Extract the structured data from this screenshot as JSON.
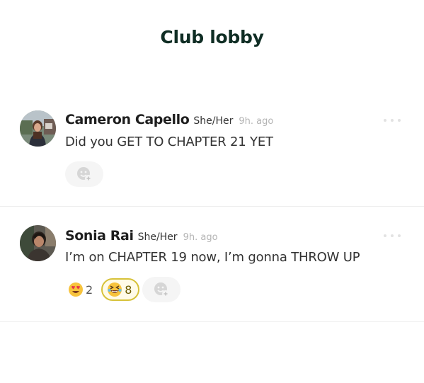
{
  "page": {
    "title": "Club lobby"
  },
  "messages": [
    {
      "author": "Cameron Capello",
      "pronouns": "She/Her",
      "time": "9h. ago",
      "text": "Did you GET TO CHAPTER 21 YET",
      "avatar_icon": "user-photo-avatar",
      "reactions": []
    },
    {
      "author": "Sonia Rai",
      "pronouns": "She/Her",
      "time": "9h. ago",
      "text": "I’m on CHAPTER 19 now, I’m gonna THROW UP",
      "avatar_icon": "user-photo-avatar",
      "reactions": [
        {
          "emoji": "heart-eyes-emoji",
          "count": "2",
          "selected": false
        },
        {
          "emoji": "grinning-squint-emoji",
          "count": "8",
          "selected": true
        }
      ]
    }
  ],
  "icons": {
    "add_reaction": "add-reaction-icon",
    "more": "more-options-icon"
  },
  "colors": {
    "title": "#0f2d24",
    "selected_reaction_border": "#d7c23a",
    "selected_reaction_bg": "#fffbe8",
    "timestamp": "#b4b4b4"
  }
}
